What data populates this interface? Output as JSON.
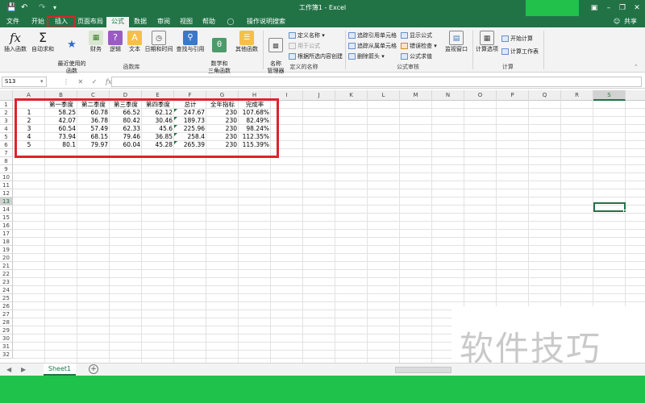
{
  "window": {
    "title": "工作簿1 - Excel",
    "share_label": "共享",
    "colors": {
      "accent": "#217346",
      "highlight": "#e0222b",
      "bar": "#1fc24a"
    }
  },
  "tabs": [
    "文件",
    "开始",
    "插入",
    "页面布局",
    "公式",
    "数据",
    "审阅",
    "视图",
    "帮助"
  ],
  "tell_me": "操作说明搜索",
  "ribbon": {
    "insert_function": "插入函数",
    "autosum": "自动求和",
    "recent": "最近使用的\n函数",
    "financial": "财务",
    "logical": "逻辑",
    "text": "文本",
    "datetime": "日期和时间",
    "lookup": "查找与引用",
    "math": "数学和\n三角函数",
    "other": "其他函数",
    "group_library": "函数库",
    "name_manager": "名称\n管理器",
    "define_name": "定义名称",
    "use_in_formula": "用于公式",
    "create_from_selection": "根据所选内容创建",
    "group_names": "定义的名称",
    "trace_precedents": "追踪引用单元格",
    "trace_dependents": "追踪从属单元格",
    "remove_arrows": "删除箭头",
    "show_formulas": "显示公式",
    "error_checking": "错误检查",
    "evaluate_formula": "公式求值",
    "watch_window": "监视窗口",
    "group_audit": "公式审核",
    "calc_options": "计算选项",
    "calc_now": "开始计算",
    "calc_sheet": "计算工作表",
    "group_calc": "计算"
  },
  "name_box": "S13",
  "columns": [
    "A",
    "B",
    "C",
    "D",
    "E",
    "F",
    "G",
    "H",
    "I",
    "J",
    "K",
    "L",
    "M",
    "N",
    "O",
    "P",
    "Q",
    "R",
    "S"
  ],
  "rows": [
    "1",
    "2",
    "3",
    "4",
    "5",
    "6",
    "7",
    "8",
    "9",
    "10",
    "11",
    "12",
    "13",
    "14",
    "15",
    "16",
    "17",
    "18",
    "19",
    "20",
    "21",
    "22",
    "23",
    "24",
    "25",
    "26",
    "27",
    "28",
    "29",
    "30",
    "31",
    "32"
  ],
  "table": {
    "headers": [
      "第一季度",
      "第二季度",
      "第三季度",
      "第四季度",
      "总计",
      "全年指标",
      "完成率"
    ],
    "rows": [
      {
        "id": "1",
        "q1": "58.25",
        "q2": "60.78",
        "q3": "66.52",
        "q4": "62.12",
        "total": "247.67",
        "target": "230",
        "rate": "107.68%"
      },
      {
        "id": "2",
        "q1": "42.07",
        "q2": "36.78",
        "q3": "80.42",
        "q4": "30.46",
        "total": "189.73",
        "target": "230",
        "rate": "82.49%"
      },
      {
        "id": "3",
        "q1": "60.54",
        "q2": "57.49",
        "q3": "62.33",
        "q4": "45.6",
        "total": "225.96",
        "target": "230",
        "rate": "98.24%"
      },
      {
        "id": "4",
        "q1": "73.94",
        "q2": "68.15",
        "q3": "79.46",
        "q4": "36.85",
        "total": "258.4",
        "target": "230",
        "rate": "112.35%"
      },
      {
        "id": "5",
        "q1": "80.1",
        "q2": "79.97",
        "q3": "60.04",
        "q4": "45.28",
        "total": "265.39",
        "target": "230",
        "rate": "115.39%"
      }
    ]
  },
  "sheet_tab": "Sheet1",
  "watermark": "软件技巧"
}
